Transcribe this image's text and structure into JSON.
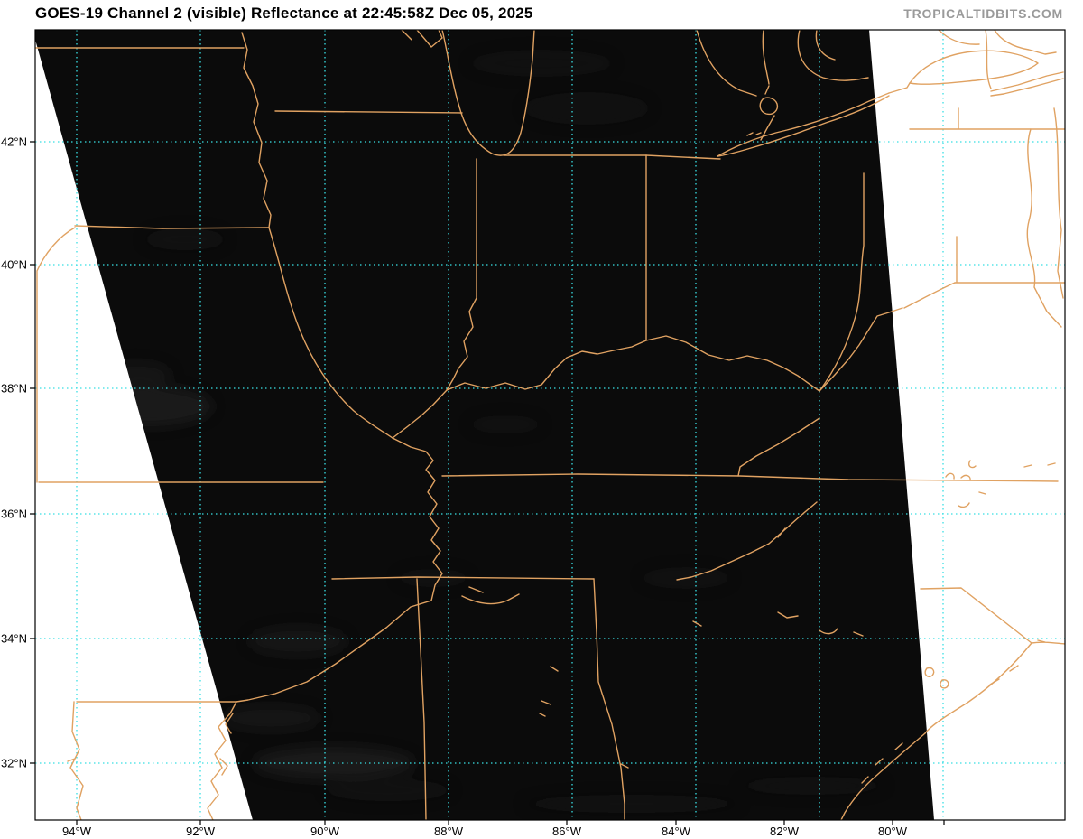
{
  "header": {
    "title": "GOES-19 Channel 2 (visible) Reflectance at 22:45:58Z Dec 05, 2025",
    "watermark": "TROPICALTIDBITS.COM"
  },
  "axes": {
    "lat_tick_labels": [
      "42°N",
      "40°N",
      "38°N",
      "36°N",
      "34°N",
      "32°N"
    ],
    "lon_tick_labels": [
      "94°W",
      "92°W",
      "90°W",
      "88°W",
      "86°W",
      "84°W",
      "82°W",
      "80°W"
    ]
  },
  "colors": {
    "map_outline": "#E0A262",
    "graticule": "#38DFE4",
    "swath_background": "#0B0B0B",
    "page_background": "#FFFFFF",
    "title_color": "#000000",
    "watermark_color": "#9A9A9A"
  }
}
